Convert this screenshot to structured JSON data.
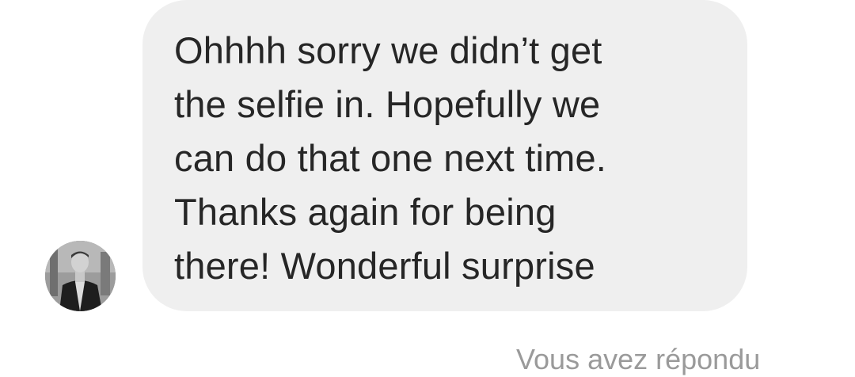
{
  "conversation": {
    "incoming_message": {
      "text": "Ohhhh sorry we didn’t get\nthe selfie in. Hopefully we\ncan do that one next time.\nThanks again for being\nthere! Wonderful surprise",
      "bubble_color": "#efefef",
      "text_color": "#262626"
    },
    "sender_avatar": {
      "icon": "profile-photo"
    },
    "reply_status": {
      "text": "Vous avez répondu",
      "color": "#9a9a9a"
    }
  }
}
